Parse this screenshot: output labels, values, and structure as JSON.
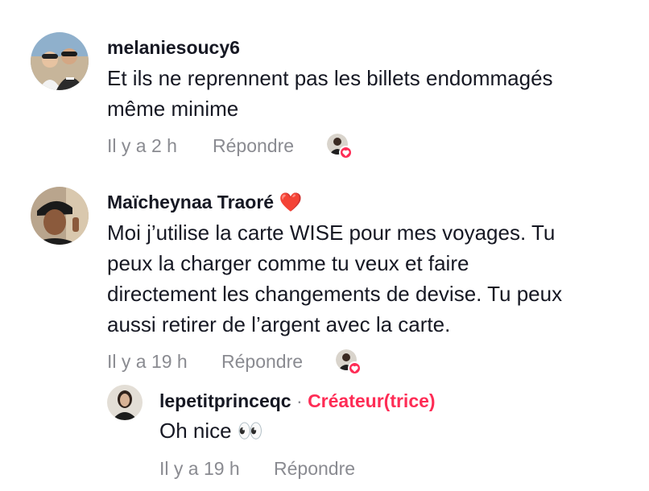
{
  "comments": [
    {
      "username": "melaniesoucy6",
      "text_lines": [
        "Et ils ne reprennent pas les billets endommagés",
        "même minime"
      ],
      "time": "Il y a 2 h",
      "reply_label": "Répondre"
    },
    {
      "username": "Maïcheynaa Traoré",
      "username_emoji": "❤️",
      "text_lines": [
        "Moi j’utilise la carte WISE pour mes voyages. Tu",
        "peux la charger comme tu veux et faire",
        "directement les changements de devise. Tu peux",
        "aussi retirer de l’argent avec la carte."
      ],
      "time": "Il y a 19 h",
      "reply_label": "Répondre"
    }
  ],
  "reply": {
    "username": "lepetitprinceqc",
    "separator": "·",
    "creator_label": "Créateur(trice)",
    "text": "Oh nice",
    "emoji": "👀",
    "time": "Il y a 19 h",
    "reply_label": "Répondre"
  },
  "colors": {
    "accent": "#fe2c55",
    "meta_text": "#8a8b91",
    "primary_text": "#161823"
  },
  "icons": {
    "liked_by_creator": "creator-avatar-with-heart-icon"
  }
}
